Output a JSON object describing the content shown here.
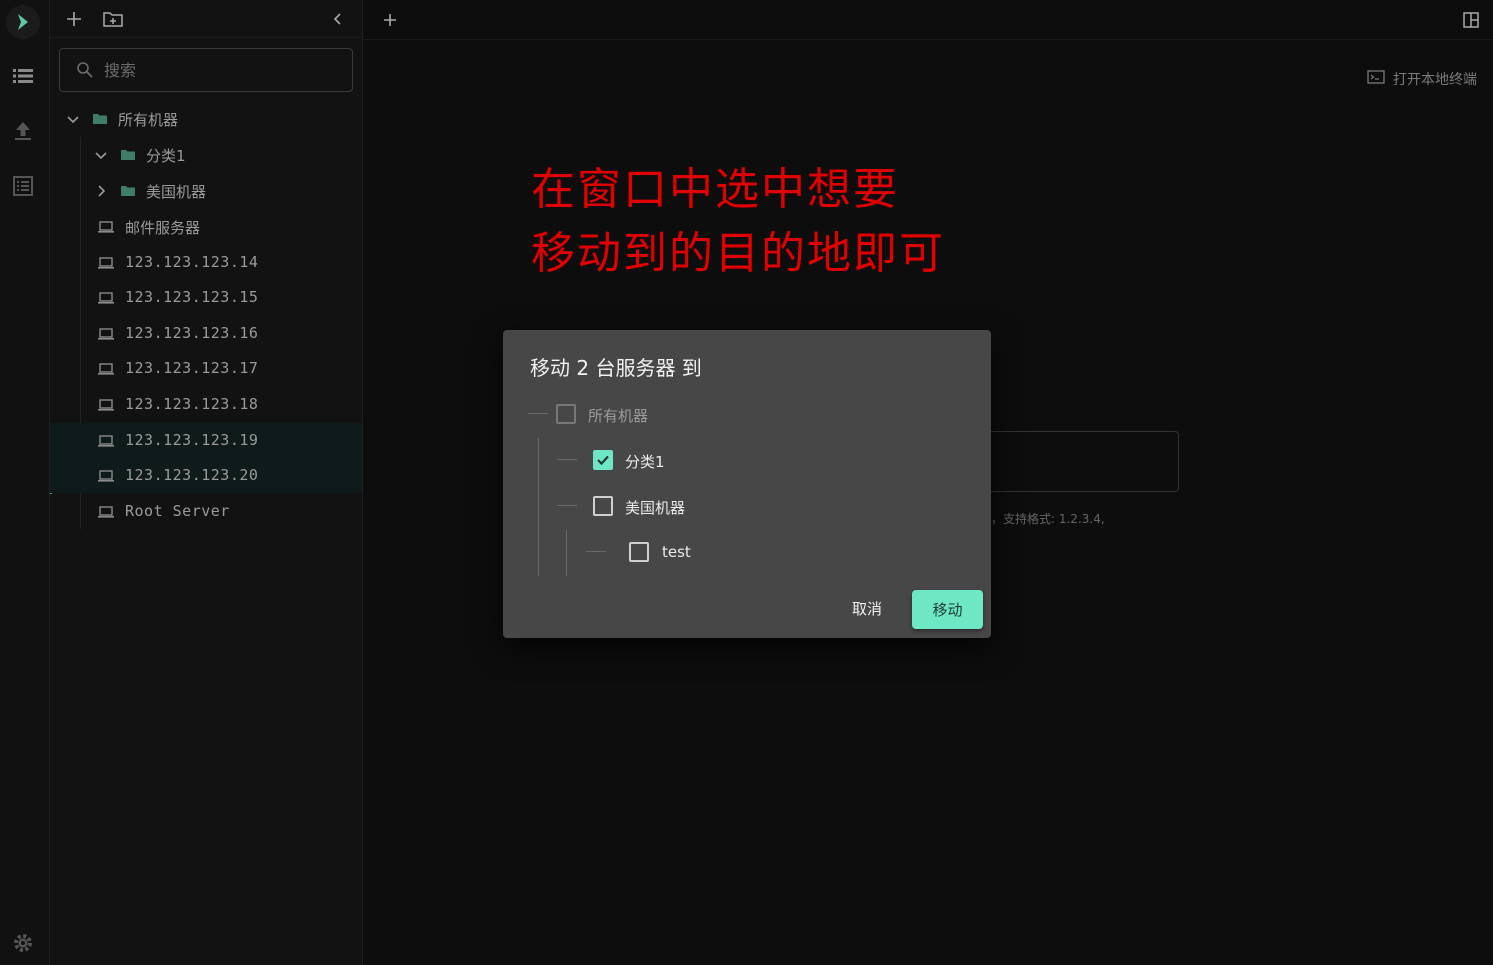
{
  "rail": {
    "icons": [
      "logo-icon",
      "server-list-icon",
      "upload-icon",
      "log-list-icon",
      "settings-icon"
    ]
  },
  "sidebar": {
    "search_placeholder": "搜索",
    "tree": {
      "root": "所有机器",
      "folder1": "分类1",
      "folder2": "美国机器",
      "servers": [
        "邮件服务器",
        "123.123.123.14",
        "123.123.123.15",
        "123.123.123.16",
        "123.123.123.17",
        "123.123.123.18",
        "123.123.123.19",
        "123.123.123.20",
        "Root Server"
      ]
    }
  },
  "main": {
    "terminal_link": "打开本地终端",
    "annotation_line1": "在窗口中选中想要",
    "annotation_line2": "移动到的目的地即可",
    "hint_fragment": "），支持格式: 1.2.3.4,"
  },
  "dialog": {
    "title": "移动 2 台服务器 到",
    "options": {
      "root": "所有机器",
      "folder1": "分类1",
      "folder2": "美国机器",
      "sub": "test"
    },
    "checked": {
      "root": false,
      "folder1": true,
      "folder2": false,
      "sub": false
    },
    "cancel_label": "取消",
    "move_label": "移动"
  },
  "colors": {
    "accent": "#6ee7c4",
    "annotation": "#e00000",
    "dialog_bg": "#474747"
  }
}
